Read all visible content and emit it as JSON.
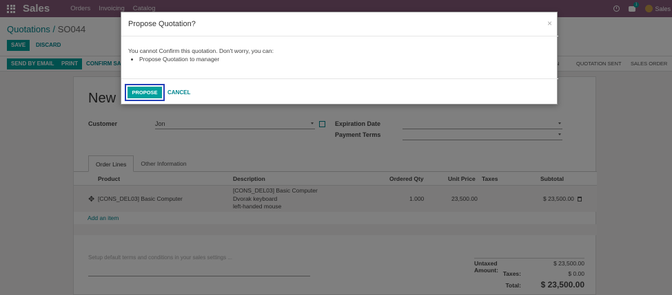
{
  "navbar": {
    "app_name": "Sales",
    "menu": [
      "Orders",
      "Invoicing",
      "Catalog"
    ],
    "chat_badge": "1",
    "user_name": "Sales"
  },
  "breadcrumb": {
    "parent": "Quotations",
    "separator": "/",
    "current": "SO044"
  },
  "form_buttons": {
    "save": "SAVE",
    "discard": "DISCARD"
  },
  "status_buttons": {
    "send_email": "SEND BY EMAIL",
    "print": "PRINT",
    "confirm": "CONFIRM SALE"
  },
  "stages": {
    "partial": "N",
    "sent": "QUOTATION SENT",
    "order": "SALES ORDER"
  },
  "form": {
    "title": "New",
    "customer_label": "Customer",
    "customer_value": "Jon",
    "expiration_label": "Expiration Date",
    "expiration_value": "",
    "payment_terms_label": "Payment Terms",
    "payment_terms_value": ""
  },
  "tabs": [
    "Order Lines",
    "Other Information"
  ],
  "lines": {
    "headers": {
      "product": "Product",
      "description": "Description",
      "qty": "Ordered Qty",
      "price": "Unit Price",
      "taxes": "Taxes",
      "subtotal": "Subtotal"
    },
    "rows": [
      {
        "product": "[CONS_DEL03] Basic Computer",
        "description": [
          "[CONS_DEL03] Basic Computer",
          "Dvorak keyboard",
          "left-handed mouse"
        ],
        "qty": "1.000",
        "price": "23,500.00",
        "taxes": "",
        "subtotal": "$ 23,500.00"
      }
    ],
    "add_item": "Add an item"
  },
  "terms_placeholder": "Setup default terms and conditions in your sales settings ...",
  "totals": {
    "untaxed_label": "Untaxed Amount:",
    "untaxed_value": "$ 23,500.00",
    "taxes_label": "Taxes:",
    "taxes_value": "$ 0.00",
    "total_label": "Total:",
    "total_value": "$ 23,500.00"
  },
  "modal": {
    "title": "Propose Quotation?",
    "close": "×",
    "message": "You cannot Confirm this quotation. Don't worry, you can:",
    "bullets": [
      "Propose Quotation to manager"
    ],
    "propose": "PROPOSE",
    "cancel": "CANCEL"
  },
  "colors": {
    "navbar": "#875a7b",
    "primary": "#00a09d",
    "link": "#00858f",
    "focus_outline": "#2540b8"
  }
}
